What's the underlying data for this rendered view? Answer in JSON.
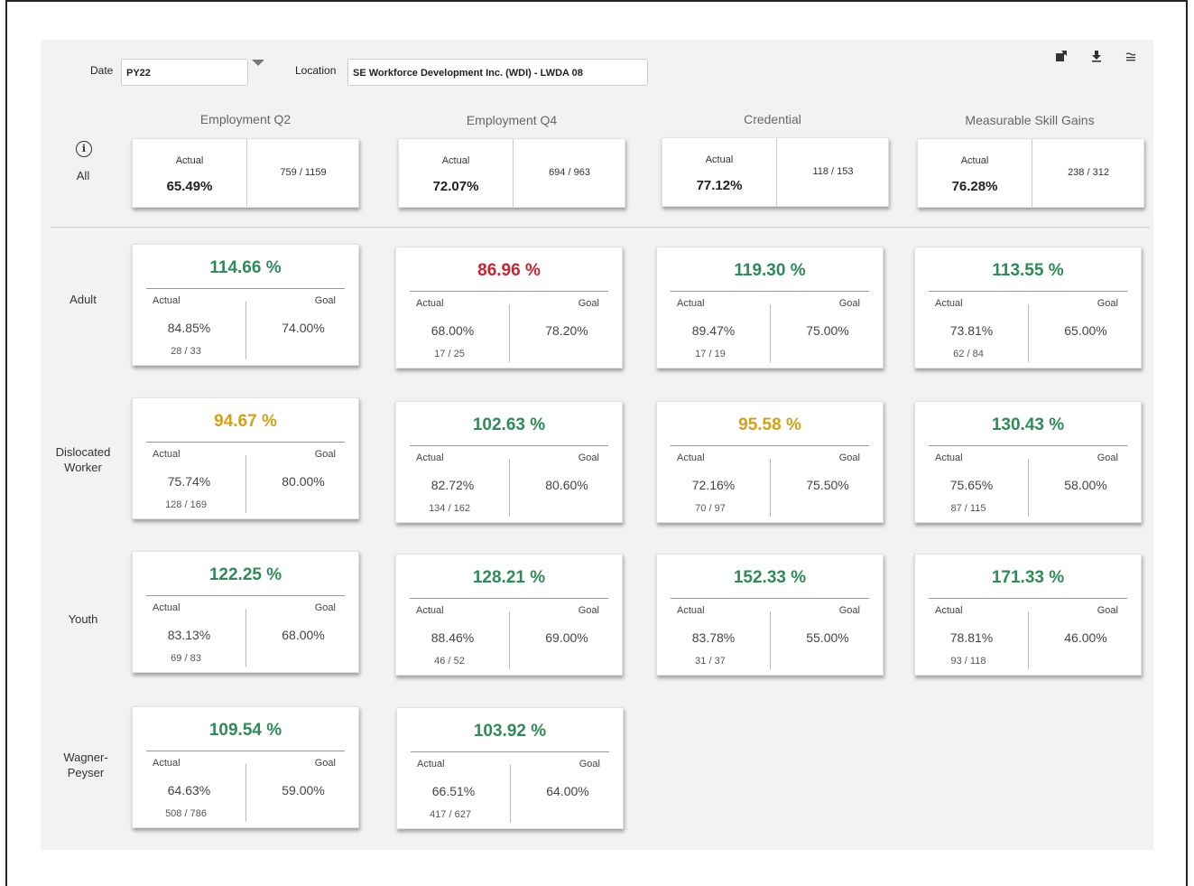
{
  "filters": {
    "date_label": "Date",
    "date_value": "PY22",
    "location_label": "Location",
    "location_value": "SE Workforce Development Inc. (WDI) - LWDA 08"
  },
  "toolbar": [
    "export-icon",
    "download-icon",
    "filter-icon"
  ],
  "columns": [
    "Employment Q2",
    "Employment Q4",
    "Credential",
    "Measurable  Skill Gains"
  ],
  "all_row": {
    "label": "All",
    "cards": [
      {
        "actual_label": "Actual",
        "actual": "65.49%",
        "fraction": "759 /  1159"
      },
      {
        "actual_label": "Actual",
        "actual": "72.07%",
        "fraction": "694  /  963"
      },
      {
        "actual_label": "Actual",
        "actual": "77.12%",
        "fraction": "118 /  153"
      },
      {
        "actual_label": "Actual",
        "actual": "76.28%",
        "fraction": "238  /  312"
      }
    ]
  },
  "rows": [
    {
      "label": "Adult",
      "cards": [
        {
          "pct": "114.66 %",
          "status": "green",
          "actual_label": "Actual",
          "goal_label": "Goal",
          "actual": "84.85%",
          "goal": "74.00%",
          "fraction": "28  /  33"
        },
        {
          "pct": "86.96 %",
          "status": "red",
          "actual_label": "Actual",
          "goal_label": "Goal",
          "actual": "68.00%",
          "goal": "78.20%",
          "fraction": "17  /  25"
        },
        {
          "pct": "119.30 %",
          "status": "green",
          "actual_label": "Actual",
          "goal_label": "Goal",
          "actual": "89.47%",
          "goal": "75.00%",
          "fraction": "17  /  19"
        },
        {
          "pct": "113.55 %",
          "status": "green",
          "actual_label": "Actual",
          "goal_label": "Goal",
          "actual": "73.81%",
          "goal": "65.00%",
          "fraction": "62  /  84"
        }
      ]
    },
    {
      "label": "Dislocated Worker",
      "cards": [
        {
          "pct": "94.67 %",
          "status": "amber",
          "actual_label": "Actual",
          "goal_label": "Goal",
          "actual": "75.74%",
          "goal": "80.00%",
          "fraction": "128 / 169"
        },
        {
          "pct": "102.63 %",
          "status": "green",
          "actual_label": "Actual",
          "goal_label": "Goal",
          "actual": "82.72%",
          "goal": "80.60%",
          "fraction": "134  /  162"
        },
        {
          "pct": "95.58 %",
          "status": "amber",
          "actual_label": "Actual",
          "goal_label": "Goal",
          "actual": "72.16%",
          "goal": "75.50%",
          "fraction": "70  /  97"
        },
        {
          "pct": "130.43 %",
          "status": "green",
          "actual_label": "Actual",
          "goal_label": "Goal",
          "actual": "75.65%",
          "goal": "58.00%",
          "fraction": "87  /  115"
        }
      ]
    },
    {
      "label": "Youth",
      "cards": [
        {
          "pct": "122.25 %",
          "status": "green",
          "actual_label": "Actual",
          "goal_label": "Goal",
          "actual": "83.13%",
          "goal": "68.00%",
          "fraction": "69  /  83"
        },
        {
          "pct": "128.21 %",
          "status": "green",
          "actual_label": "Actual",
          "goal_label": "Goal",
          "actual": "88.46%",
          "goal": "69.00%",
          "fraction": "46  /  52"
        },
        {
          "pct": "152.33 %",
          "status": "green",
          "actual_label": "Actual",
          "goal_label": "Goal",
          "actual": "83.78%",
          "goal": "55.00%",
          "fraction": "31  /  37"
        },
        {
          "pct": "171.33 %",
          "status": "green",
          "actual_label": "Actual",
          "goal_label": "Goal",
          "actual": "78.81%",
          "goal": "46.00%",
          "fraction": "93  /  118"
        }
      ]
    },
    {
      "label": "Wagner-Peyser",
      "cards": [
        {
          "pct": "109.54 %",
          "status": "green",
          "actual_label": "Actual",
          "goal_label": "Goal",
          "actual": "64.63%",
          "goal": "59.00%",
          "fraction": "508  /  786"
        },
        {
          "pct": "103.92 %",
          "status": "green",
          "actual_label": "Actual",
          "goal_label": "Goal",
          "actual": "66.51%",
          "goal": "64.00%",
          "fraction": "417  /  627"
        }
      ]
    }
  ]
}
